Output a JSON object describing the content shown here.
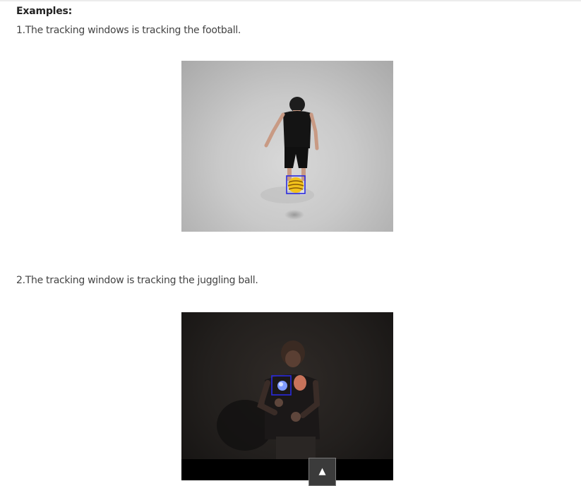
{
  "heading": "Examples:",
  "examples": [
    {
      "caption": "1.The tracking windows is tracking the football."
    },
    {
      "caption": "2.The tracking window is tracking the juggling ball."
    }
  ],
  "scroll_top": {
    "icon": "up-triangle-icon",
    "glyph": "▲"
  },
  "colors": {
    "tracking_window": "#2a2adf",
    "football": "#f2c21b",
    "juggling_ball": "#7f9bff"
  }
}
